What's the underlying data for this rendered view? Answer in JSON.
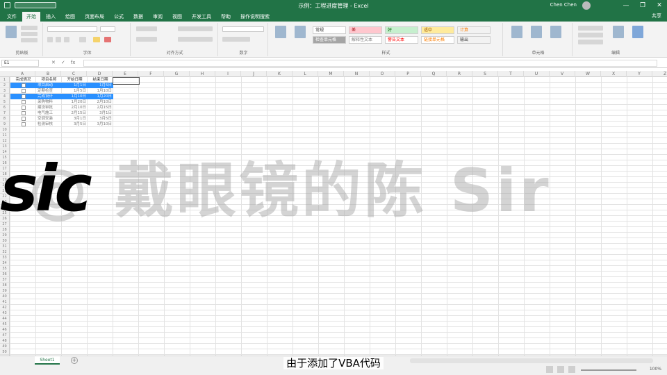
{
  "title_bar": {
    "title": "示例：工程进度管理 - Excel",
    "user": "Chen Chen",
    "window_buttons": [
      "—",
      "❐",
      "✕"
    ]
  },
  "tabs": [
    {
      "label": "文件",
      "active": false
    },
    {
      "label": "开始",
      "active": true
    },
    {
      "label": "插入",
      "active": false
    },
    {
      "label": "绘图",
      "active": false
    },
    {
      "label": "页面布局",
      "active": false
    },
    {
      "label": "公式",
      "active": false
    },
    {
      "label": "数据",
      "active": false
    },
    {
      "label": "审阅",
      "active": false
    },
    {
      "label": "视图",
      "active": false
    },
    {
      "label": "开发工具",
      "active": false
    },
    {
      "label": "帮助",
      "active": false
    },
    {
      "label": "操作说明搜索",
      "active": false
    }
  ],
  "share_label": "共享",
  "ribbon": {
    "groups": [
      "剪贴板",
      "字体",
      "对齐方式",
      "数字",
      "样式",
      "单元格",
      "编辑"
    ],
    "styles": [
      {
        "label": "常规",
        "bg": "#ffffff",
        "fg": "#333333"
      },
      {
        "label": "差",
        "bg": "#ffc7ce",
        "fg": "#9c0006"
      },
      {
        "label": "好",
        "bg": "#c6efce",
        "fg": "#006100"
      },
      {
        "label": "适中",
        "bg": "#ffeb9c",
        "fg": "#9c5700"
      },
      {
        "label": "计算",
        "bg": "#f2f2f2",
        "fg": "#fa7d00"
      },
      {
        "label": "检查单元格",
        "bg": "#a5a5a5",
        "fg": "#ffffff"
      },
      {
        "label": "解释性文本",
        "bg": "#ffffff",
        "fg": "#7f7f7f"
      },
      {
        "label": "警告文本",
        "bg": "#ffffff",
        "fg": "#ff0000"
      },
      {
        "label": "链接单元格",
        "bg": "#ffffff",
        "fg": "#fa7d00"
      },
      {
        "label": "输出",
        "bg": "#f2f2f2",
        "fg": "#3f3f3f"
      }
    ]
  },
  "formula_bar": {
    "name_box": "E1",
    "fx_icons": [
      "✕",
      "✓",
      "fx"
    ]
  },
  "columns": [
    "A",
    "B",
    "C",
    "D",
    "E",
    "F",
    "G",
    "H",
    "I",
    "J",
    "K",
    "L",
    "M",
    "N",
    "O",
    "P",
    "Q",
    "R",
    "S",
    "T",
    "U",
    "V",
    "W",
    "X",
    "Y",
    "Z"
  ],
  "table": {
    "headers": [
      "完成情况",
      "项目名称",
      "开始日期",
      "结束日期"
    ],
    "rows": [
      {
        "checked": true,
        "name": "项目启动",
        "start": "1月1日",
        "end": "1月5日",
        "selected": true
      },
      {
        "checked": false,
        "name": "定期检查",
        "start": "1月5日",
        "end": "1月10日",
        "selected": false
      },
      {
        "checked": true,
        "name": "完成设计",
        "start": "1月10日",
        "end": "1月20日",
        "selected": true
      },
      {
        "checked": false,
        "name": "采购物料",
        "start": "1月20日",
        "end": "2月10日",
        "selected": false
      },
      {
        "checked": false,
        "name": "建设审批",
        "start": "2月10日",
        "end": "2月15日",
        "selected": false
      },
      {
        "checked": false,
        "name": "电气施工",
        "start": "2月15日",
        "end": "3月1日",
        "selected": false
      },
      {
        "checked": false,
        "name": "空调安装",
        "start": "3月1日",
        "end": "3月5日",
        "selected": false
      },
      {
        "checked": false,
        "name": "检测审核",
        "start": "3月5日",
        "end": "3月10日",
        "selected": false
      }
    ]
  },
  "watermark": "@ 戴眼镜的陈 Sir",
  "brand_text": "sic",
  "sheet_tab": "Sheet1",
  "add_sheet": "+",
  "zoom": "100%",
  "subtitle": "由于添加了VBA代码"
}
